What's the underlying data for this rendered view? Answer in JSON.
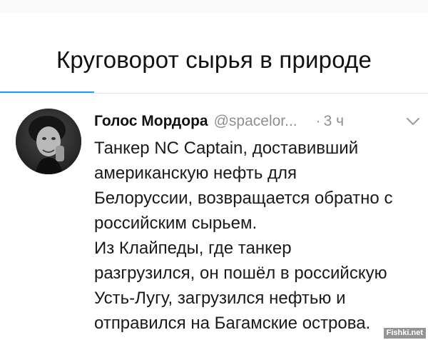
{
  "page": {
    "title": "Круговорот сырья в природе"
  },
  "tweet": {
    "author_name": "Голос Мордора",
    "author_handle": "@spacelor...",
    "separator": "·",
    "timestamp": "3 ч",
    "avatar_icon": "user-avatar-photo",
    "menu_icon": "chevron-down-icon",
    "body_lines": [
      "Танкер NC Captain, доставивший",
      "американскую нефть для",
      "Белоруссии, возвращается обратно с",
      "российским сырьем.",
      "Из Клайпеды, где танкер",
      "разгрузился, он пошёл в российскую",
      "Усть-Лугу, загрузился нефтью и",
      "отправился на Багамские острова."
    ]
  },
  "watermark": {
    "text": "Fishki.net"
  },
  "colors": {
    "accent": "#1da1f2",
    "muted": "#8f8f8f",
    "text": "#111111"
  }
}
